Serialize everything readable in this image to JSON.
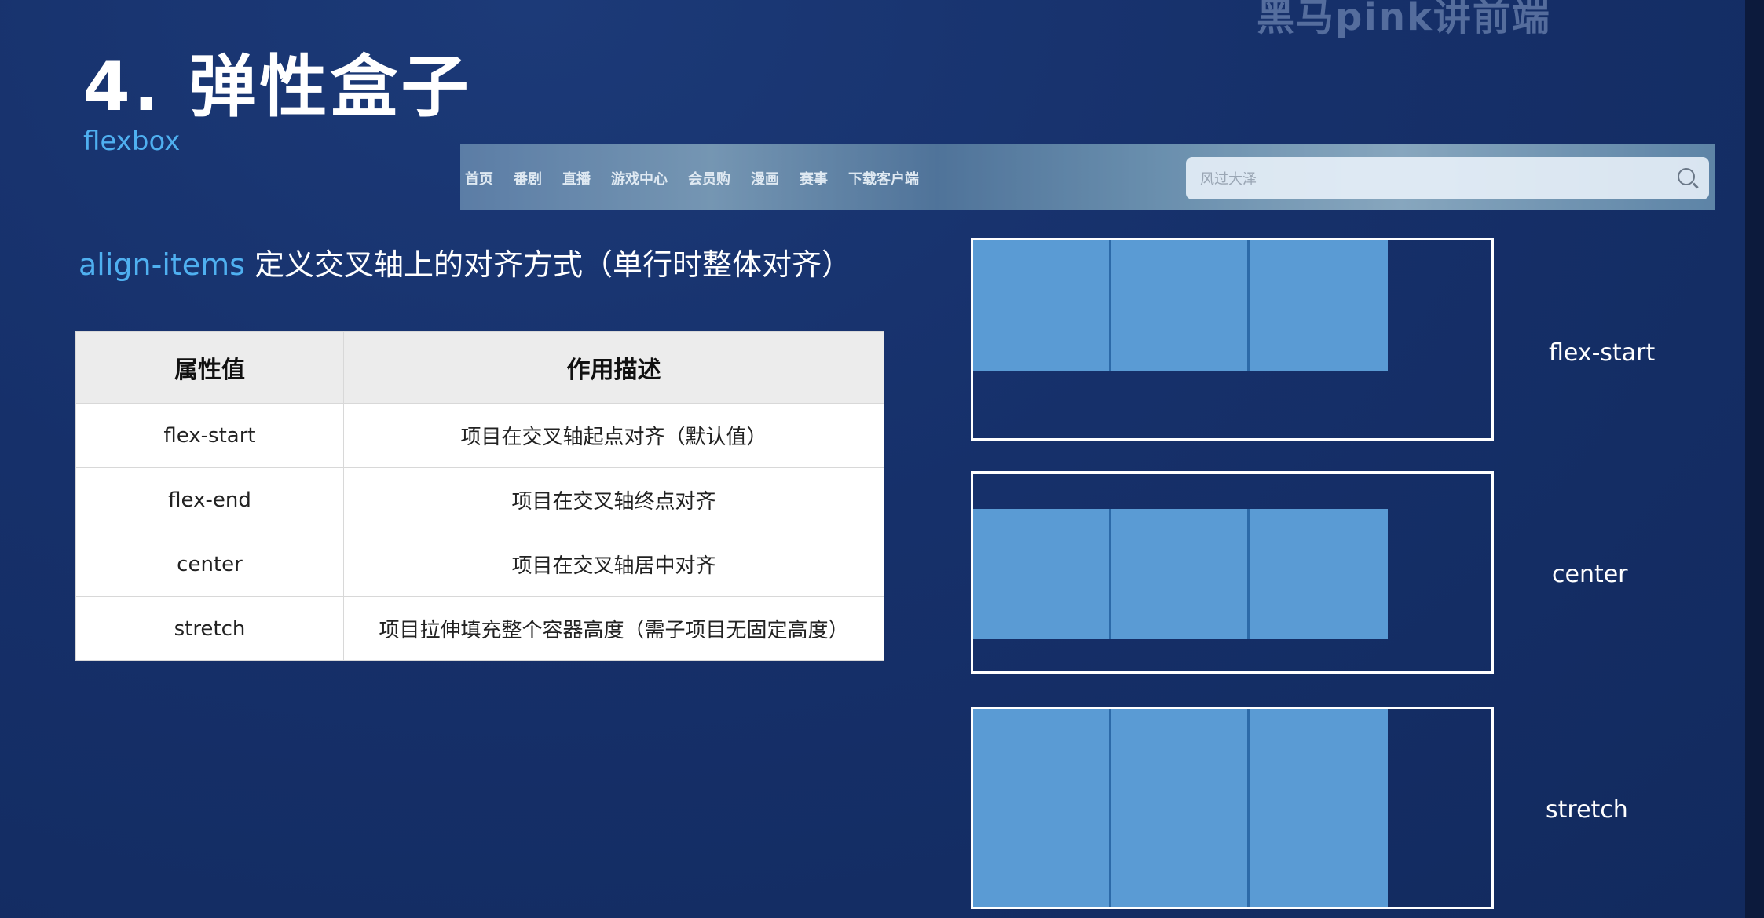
{
  "watermark": "黑马pink讲前端",
  "title": "4. 弹性盒子",
  "subtitle": "flexbox",
  "browser_strip": {
    "nav": [
      "首页",
      "番剧",
      "直播",
      "游戏中心",
      "会员购",
      "漫画",
      "赛事",
      "下载客户端"
    ],
    "search_placeholder": "风过大泽"
  },
  "description": {
    "keyword": "align-items",
    "text": " 定义交叉轴上的对齐方式（单行时整体对齐）"
  },
  "table": {
    "headers": [
      "属性值",
      "作用描述"
    ],
    "rows": [
      [
        "flex-start",
        "项目在交叉轴起点对齐（默认值）"
      ],
      [
        "flex-end",
        "项目在交叉轴终点对齐"
      ],
      [
        "center",
        "项目在交叉轴居中对齐"
      ],
      [
        "stretch",
        "项目拉伸填充整个容器高度（需子项目无固定高度）"
      ]
    ]
  },
  "demos": [
    {
      "label": "flex-start"
    },
    {
      "label": "center"
    },
    {
      "label": "stretch"
    }
  ],
  "colors": {
    "accent": "#4fb0f0",
    "item_fill": "#5a9bd4",
    "background": "#16306a"
  }
}
